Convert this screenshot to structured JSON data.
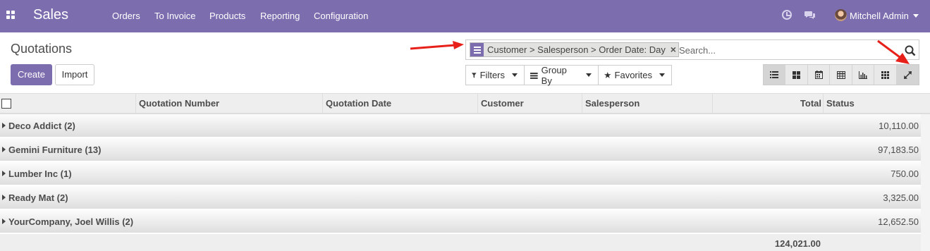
{
  "navbar": {
    "app_name": "Sales",
    "menu": [
      "Orders",
      "To Invoice",
      "Products",
      "Reporting",
      "Configuration"
    ],
    "user_name": "Mitchell Admin",
    "icons": [
      "apps-grid-icon",
      "clock-icon",
      "chat-icon"
    ],
    "color": "#7c6daf"
  },
  "control_panel": {
    "title": "Quotations",
    "create_label": "Create",
    "import_label": "Import",
    "search": {
      "facet": "Customer > Salesperson > Order Date: Day",
      "placeholder": "Search..."
    },
    "filters_label": "Filters",
    "group_by_label": "Group By",
    "favorites_label": "Favorites",
    "views": [
      "list",
      "kanban",
      "calendar",
      "pivot",
      "graph",
      "activity",
      "expand"
    ]
  },
  "table": {
    "columns": [
      "Quotation Number",
      "Quotation Date",
      "Customer",
      "Salesperson",
      "Total",
      "Status"
    ],
    "groups": [
      {
        "label": "Deco Addict (2)",
        "total": "10,110.00"
      },
      {
        "label": "Gemini Furniture (13)",
        "total": "97,183.50"
      },
      {
        "label": "Lumber Inc (1)",
        "total": "750.00"
      },
      {
        "label": "Ready Mat (2)",
        "total": "3,325.00"
      },
      {
        "label": "YourCompany, Joel Willis (2)",
        "total": "12,652.50"
      }
    ],
    "grand_total": "124,021.00"
  },
  "annotation_color": "#e8201a"
}
